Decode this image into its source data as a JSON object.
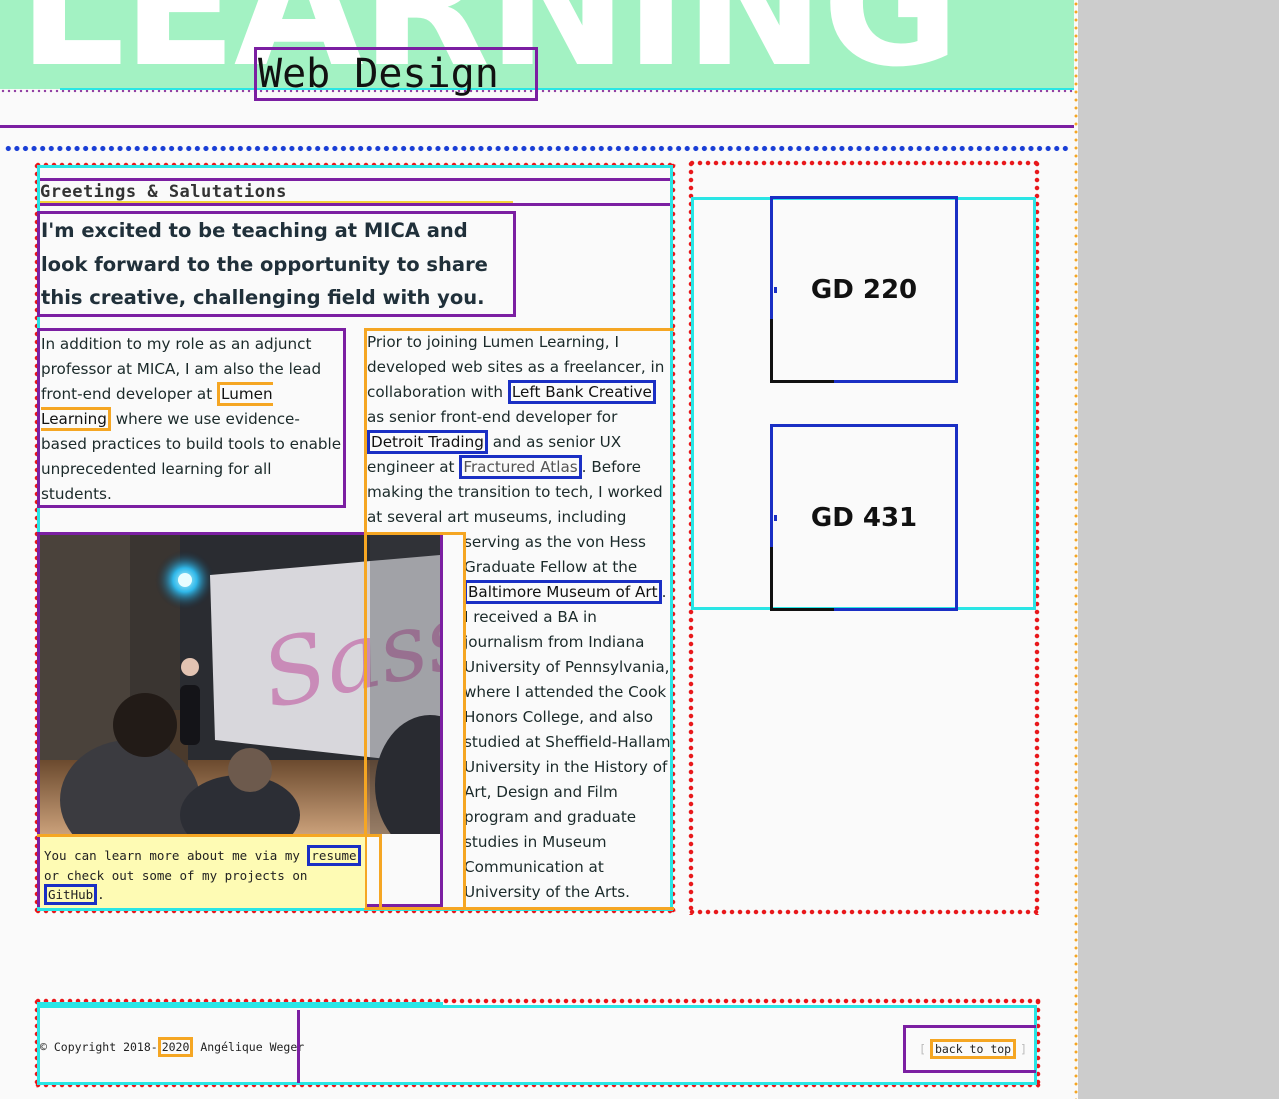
{
  "header": {
    "hero_word": "LEARNING",
    "site_title": "Web Design"
  },
  "intro": {
    "section_title": "Greetings & Salutations",
    "lead": "I'm excited to be teaching at MICA and look forward to the opportunity to share this creative, challenging field with you."
  },
  "para1": {
    "text_before": "In addition to my role as an adjunct professor at MICA, I am also the lead front-end developer at ",
    "link_lumen": "Lumen Learning",
    "text_after": " where we use evidence-based practices to build tools to enable unprecedented learning for all students."
  },
  "para2": {
    "t1": "Prior to joining Lumen Learning, I developed web sites as a freelancer, in collaboration with ",
    "link_leftbank": "Left Bank Creative",
    "t2": " as senior front-end developer for ",
    "link_detroit": "Detroit Trading",
    "t3": " and as senior UX engineer at ",
    "link_fractured": "Fractured Atlas",
    "t4": ". Before making the transition to tech, I worked at several art museums, including",
    "t5": "serving as the von Hess Graduate Fellow at the ",
    "link_bma": "Baltimore Museum of Art",
    "t6": ". I received a BA in journalism from Indiana University of Pennsylvania, where I attended the Cook Honors College, and also studied at Sheffield-Hallam University in the History of Art, Design and Film program and graduate studies in Museum Communication at University of the Arts."
  },
  "photo": {
    "screen_text": "Sass"
  },
  "learn_more": {
    "t1": "You can learn more about me via my ",
    "link_resume": "resume",
    "t2": " or check out some of my projects on ",
    "link_github": "GitHub",
    "t3": "."
  },
  "sidebar": {
    "courses": [
      {
        "label": "GD 220"
      },
      {
        "label": "GD 431"
      }
    ]
  },
  "footer": {
    "copyright_prefix": "© Copyright 2018-",
    "copyright_year": "2020",
    "copyright_suffix": " Angélique Weger",
    "bracket_open": "[",
    "back_to_top": "back to top",
    "bracket_close": "]"
  },
  "colors": {
    "hero_bg": "#a3f2c3",
    "outline_purple": "#7b1fa2",
    "outline_blue": "#1a2fc4",
    "outline_orange": "#f5a623",
    "outline_cyan": "#29e5e5",
    "outline_red_dots": "#e8181b",
    "callout_yellow": "#fefbb4"
  }
}
